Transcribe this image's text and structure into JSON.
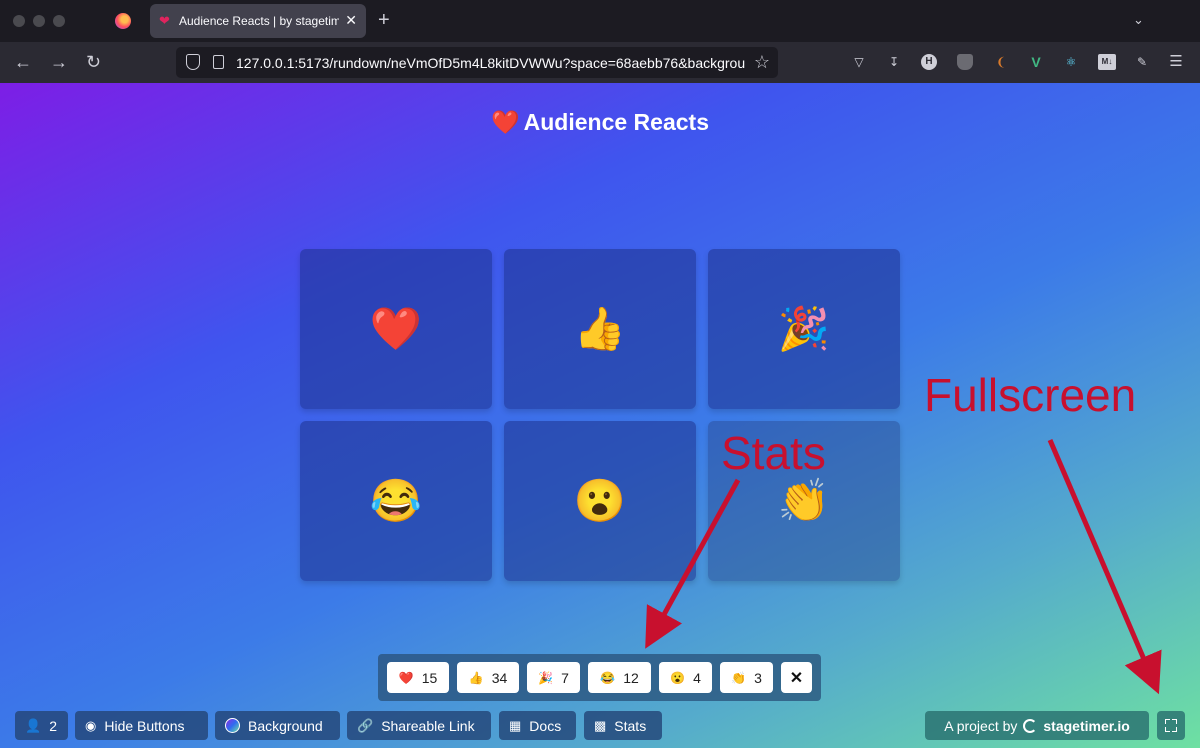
{
  "browser": {
    "tab": {
      "title": "Audience Reacts | by stagetimer",
      "icon": "heart-emoji",
      "close": "✕"
    },
    "new_tab": "+",
    "url": "127.0.0.1:5173/rundown/neVmOfD5m4L8kitDVWWu?space=68aebb76&backgrou",
    "extensions": [
      "pocket-icon",
      "download-icon",
      "H",
      "ublock-icon",
      "chili-icon",
      "vue-devtools-icon",
      "react-devtools-icon",
      "markdown-icon",
      "extensions-icon",
      "menu-icon"
    ]
  },
  "app": {
    "title": "Audience Reacts",
    "title_icon": "❤️",
    "reactions": [
      "❤️",
      "👍",
      "🎉",
      "😂",
      "😮",
      "👏"
    ]
  },
  "annotations": {
    "stats": "Stats",
    "fullscreen": "Fullscreen",
    "color": "#c8102e"
  },
  "stats": [
    {
      "emoji": "❤️",
      "count": "15"
    },
    {
      "emoji": "👍",
      "count": "34"
    },
    {
      "emoji": "🎉",
      "count": "7"
    },
    {
      "emoji": "😂",
      "count": "12"
    },
    {
      "emoji": "😮",
      "count": "4"
    },
    {
      "emoji": "👏",
      "count": "3"
    }
  ],
  "stats_close": "✕",
  "toolbar": {
    "users_count": "2",
    "hide_buttons": "Hide Buttons",
    "background": "Background",
    "shareable_link": "Shareable Link",
    "docs": "Docs",
    "stats": "Stats"
  },
  "credit": {
    "prefix": "A project by",
    "brand": "stagetimer.io"
  }
}
